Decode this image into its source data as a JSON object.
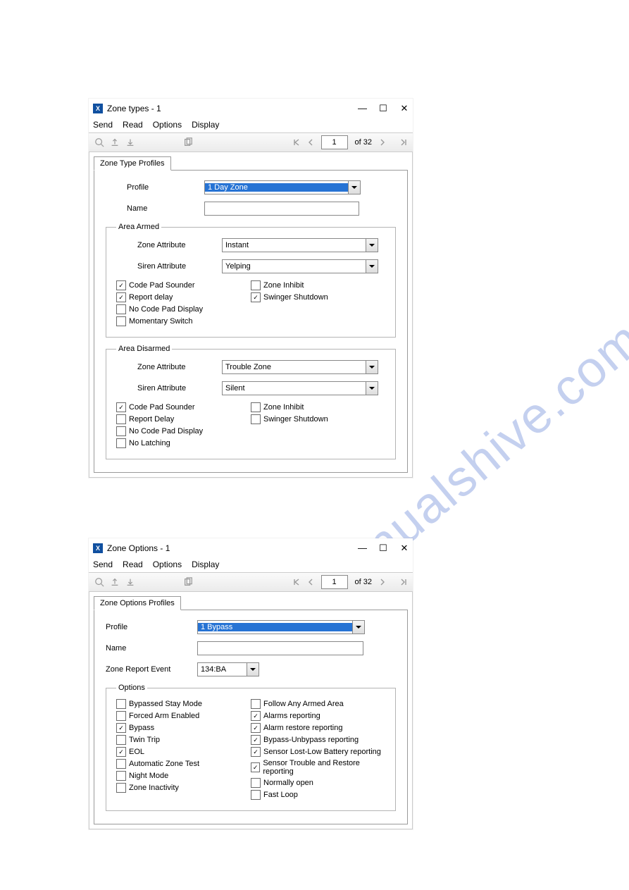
{
  "watermark": "manualshive.com",
  "menu": {
    "send": "Send",
    "read": "Read",
    "options": "Options",
    "display": "Display"
  },
  "pager": {
    "cur": "1",
    "total": "of 32"
  },
  "win1": {
    "title": "Zone types - 1",
    "tab": "Zone Type Profiles",
    "profile_lbl": "Profile",
    "profile_val": "1 Day Zone",
    "name_lbl": "Name",
    "name_val": "",
    "armed": {
      "legend": "Area Armed",
      "za_lbl": "Zone Attribute",
      "za_val": "Instant",
      "sa_lbl": "Siren Attribute",
      "sa_val": "Yelping",
      "c1": "Code Pad Sounder",
      "c2": "Report delay",
      "c3": "No Code Pad Display",
      "c4": "Momentary Switch",
      "c5": "Zone Inhibit",
      "c6": "Swinger Shutdown"
    },
    "disarmed": {
      "legend": "Area Disarmed",
      "za_lbl": "Zone Attribute",
      "za_val": "Trouble Zone",
      "sa_lbl": "Siren Attribute",
      "sa_val": "Silent",
      "c1": "Code Pad Sounder",
      "c2": "Report Delay",
      "c3": "No Code Pad Display",
      "c4": "No Latching",
      "c5": "Zone Inhibit",
      "c6": "Swinger Shutdown"
    }
  },
  "win2": {
    "title": "Zone Options - 1",
    "tab": "Zone Options Profiles",
    "profile_lbl": "Profile",
    "profile_val": "1 Bypass",
    "name_lbl": "Name",
    "name_val": "",
    "zre_lbl": "Zone Report Event",
    "zre_val": "134:BA",
    "opt": {
      "legend": "Options",
      "l1": "Bypassed Stay Mode",
      "l2": "Forced Arm Enabled",
      "l3": "Bypass",
      "l4": "Twin Trip",
      "l5": "EOL",
      "l6": "Automatic Zone Test",
      "l7": "Night Mode",
      "l8": "Zone Inactivity",
      "r1": "Follow Any Armed Area",
      "r2": "Alarms reporting",
      "r3": "Alarm restore reporting",
      "r4": "Bypass-Unbypass reporting",
      "r5": "Sensor Lost-Low Battery reporting",
      "r6": "Sensor Trouble and Restore reporting",
      "r7": "Normally open",
      "r8": "Fast Loop"
    }
  }
}
